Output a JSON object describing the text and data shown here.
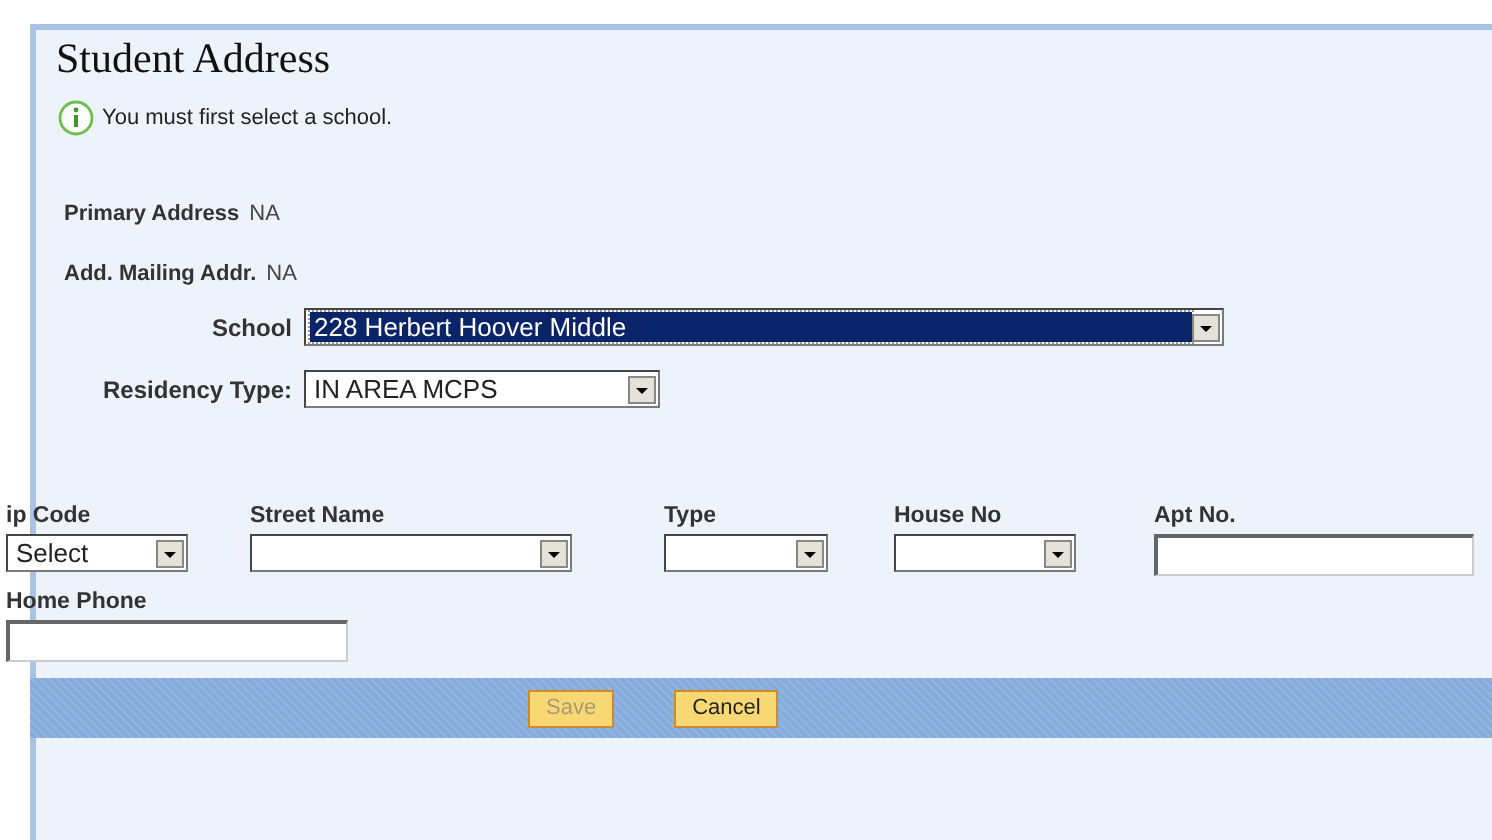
{
  "title": "Student Address",
  "notice": "You must first select a school.",
  "info_rows": [
    {
      "label": "Primary Address",
      "value": "NA"
    },
    {
      "label": "Add. Mailing Addr.",
      "value": "NA"
    }
  ],
  "school": {
    "label": "School",
    "value": "228 Herbert Hoover Middle",
    "selected": true
  },
  "residency": {
    "label": "Residency Type:",
    "value": "IN AREA MCPS",
    "selected": false
  },
  "address_fields": [
    {
      "label": "ip Code",
      "kind": "select",
      "value": "Select"
    },
    {
      "label": "Street Name",
      "kind": "select"
    },
    {
      "label": "Type",
      "kind": "select"
    },
    {
      "label": "House No",
      "kind": "select"
    },
    {
      "label": "Apt No.",
      "kind": "text"
    }
  ],
  "home_phone": {
    "label": "Home Phone"
  },
  "buttons": [
    {
      "label": "Save",
      "disabled": true
    },
    {
      "label": "Cancel",
      "disabled": false
    }
  ]
}
